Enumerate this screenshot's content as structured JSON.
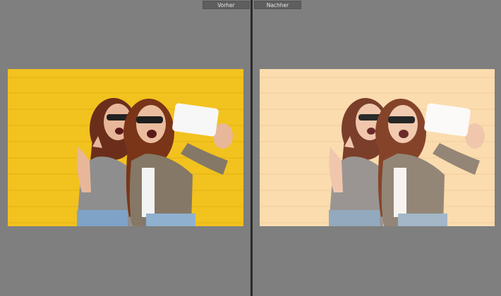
{
  "view": {
    "before_label": "Vorher",
    "after_label": "Nachher"
  },
  "colors": {
    "background": "#7f7f7f",
    "before_wall": "#f2c21e",
    "after_wall": "#fbdcae",
    "divider": "#2a2a2a",
    "label_bg": "#5e5e5e"
  },
  "images": {
    "before": "photo-selfie-yellow-wall",
    "after": "photo-selfie-peach-wall"
  }
}
